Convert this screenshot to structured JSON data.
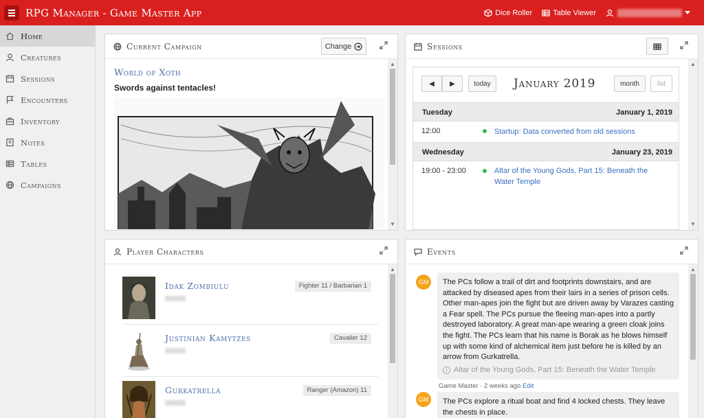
{
  "app": {
    "title": "RPG Manager - Game Master App"
  },
  "topbar": {
    "dice_roller": "Dice Roller",
    "table_viewer": "Table Viewer"
  },
  "sidebar": {
    "items": [
      {
        "label": "Home",
        "icon": "home-icon"
      },
      {
        "label": "Creatures",
        "icon": "user-icon"
      },
      {
        "label": "Sessions",
        "icon": "calendar-icon"
      },
      {
        "label": "Encounters",
        "icon": "flag-icon"
      },
      {
        "label": "Inventory",
        "icon": "briefcase-icon"
      },
      {
        "label": "Notes",
        "icon": "note-icon"
      },
      {
        "label": "Tables",
        "icon": "table-icon"
      },
      {
        "label": "Campaigns",
        "icon": "globe-icon"
      }
    ]
  },
  "campaign": {
    "title": "Current Campaign",
    "change_label": "Change",
    "name": "World of Xoth",
    "subtitle": "Swords against tentacles!"
  },
  "sessions": {
    "title": "Sessions",
    "calendar": {
      "today_label": "today",
      "month_label": "month",
      "list_label": "list",
      "title": "January 2019",
      "days": [
        {
          "weekday": "Tuesday",
          "date": "January 1, 2019",
          "events": [
            {
              "time": "12:00",
              "title": "Startup: Data converted from old sessions"
            }
          ]
        },
        {
          "weekday": "Wednesday",
          "date": "January 23, 2019",
          "events": [
            {
              "time": "19:00 - 23:00",
              "title": "Altar of the Young Gods, Part 15: Beneath the Water Temple"
            }
          ]
        }
      ]
    }
  },
  "players": {
    "title": "Player Characters",
    "list": [
      {
        "name": "Idak Zombiulu",
        "class": "Fighter 11 / Barbarian 1"
      },
      {
        "name": "Justinian Kamytzes",
        "class": "Cavalier 12"
      },
      {
        "name": "Gurkatrella",
        "class": "Ranger (Amazon) 11"
      }
    ]
  },
  "events": {
    "title": "Events",
    "items": [
      {
        "avatar": "GM",
        "text": "The PCs follow a trail of dirt and footprints downstairs, and are attacked by diseased apes from their lairs in a series of prison cells. Other man-apes join the fight but are driven away by Varazes casting a Fear spell. The PCs pursue the fleeing man-apes into a partly destroyed laboratory. A great man-ape wearing a green cloak joins the fight. The PCs learn that his name is Borak as he blows himself up with some kind of alchemical item just before he is killed by an arrow from Gurkatrella.",
        "link": "Altar of the Young Gods, Part 15: Beneath the Water Temple",
        "meta": "Game Master · 2 weeks ago",
        "edit": "Edit"
      },
      {
        "avatar": "GM",
        "text": "The PCs explore a ritual boat and find 4 locked chests. They leave the chests in place."
      }
    ]
  }
}
